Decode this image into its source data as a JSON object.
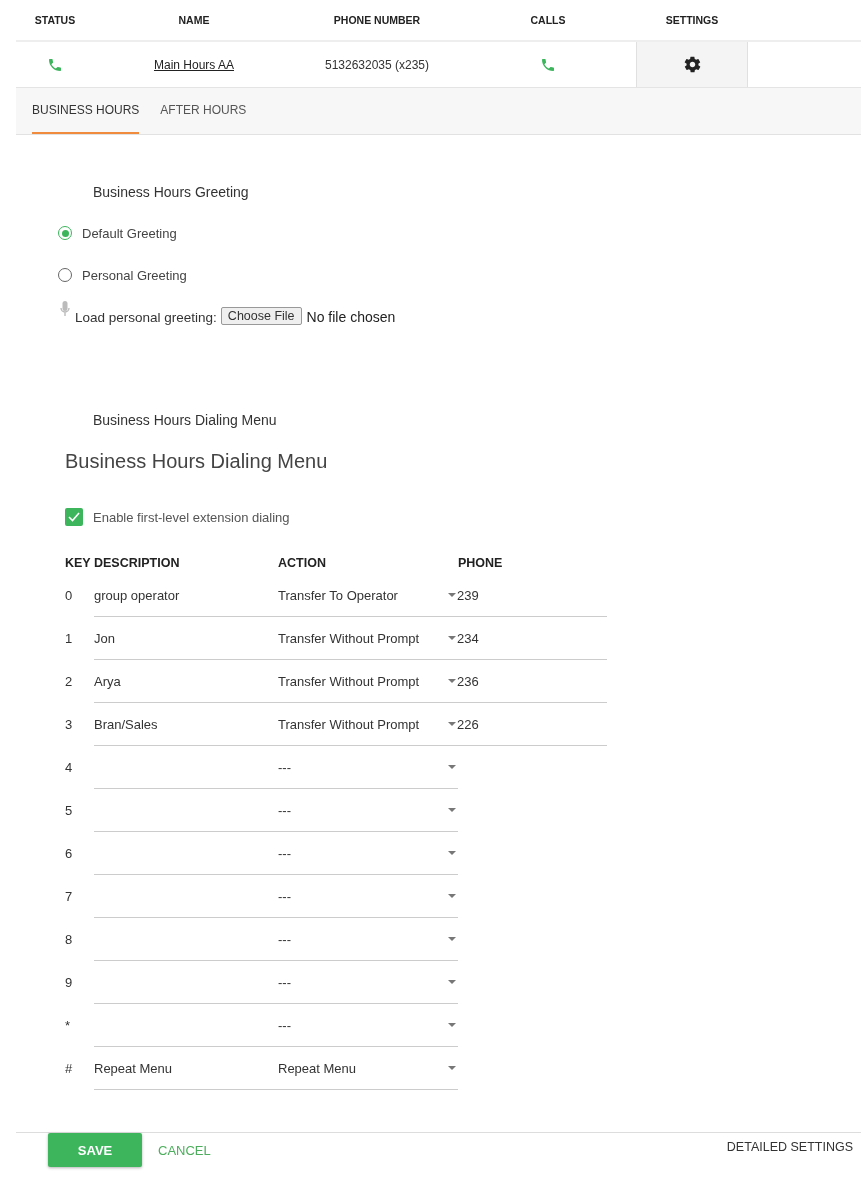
{
  "extension": {
    "columns": [
      "STATUS",
      "NAME",
      "PHONE NUMBER",
      "CALLS",
      "SETTINGS"
    ],
    "row": {
      "name": "Main Hours AA",
      "phone_number": "5132632035 (x235)"
    }
  },
  "tabs": [
    {
      "label": "BUSINESS HOURS",
      "selected": true
    },
    {
      "label": "AFTER HOURS",
      "selected": false
    }
  ],
  "greeting": {
    "title": "Business Hours Greeting",
    "options": [
      {
        "label": "Default Greeting",
        "selected": true
      },
      {
        "label": "Personal Greeting",
        "selected": false
      }
    ],
    "upload": {
      "label": "Load personal greeting:",
      "button": "Choose File",
      "status": "No file chosen"
    }
  },
  "dialing_menu": {
    "caption": "Business Hours Dialing Menu",
    "title": "Business Hours Dialing Menu",
    "extension_dialing": {
      "label": "Enable first-level extension dialing",
      "checked": true
    },
    "columns": [
      "KEY",
      "DESCRIPTION",
      "ACTION",
      "PHONE"
    ],
    "rows": [
      {
        "key": "0",
        "description": "group operator",
        "action": "Transfer To Operator",
        "phone": "239"
      },
      {
        "key": "1",
        "description": "Jon",
        "action": "Transfer Without Prompt",
        "phone": "234"
      },
      {
        "key": "2",
        "description": "Arya",
        "action": "Transfer Without Prompt",
        "phone": "236"
      },
      {
        "key": "3",
        "description": "Bran/Sales",
        "action": "Transfer Without Prompt",
        "phone": "226"
      },
      {
        "key": "4",
        "action": "---"
      },
      {
        "key": "5",
        "action": "---"
      },
      {
        "key": "6",
        "action": "---"
      },
      {
        "key": "7",
        "action": "---"
      },
      {
        "key": "8",
        "action": "---"
      },
      {
        "key": "9",
        "action": "---"
      },
      {
        "key": "*",
        "action": "---"
      },
      {
        "key": "#",
        "description": "Repeat Menu",
        "action": "Repeat Menu"
      }
    ]
  },
  "footer": {
    "save": "SAVE",
    "cancel": "CANCEL",
    "detailed_settings": "DETAILED SETTINGS"
  }
}
